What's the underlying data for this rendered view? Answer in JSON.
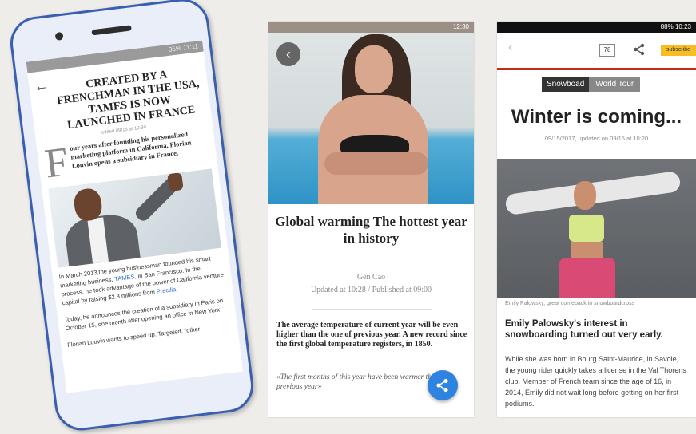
{
  "phone1": {
    "status_bar": "35% 11:11",
    "back_icon": "arrow-left-icon",
    "headline": "CREATED BY A FRENCHMAN IN THE USA, TAMES IS NOW LAUNCHED IN FRANCE",
    "edited": "edited 09/15 at 10:30",
    "dropcap": "F",
    "lede": "our years after founding his personalized marketing platform in California, Florian Louvin opens a subsidiary in France.",
    "para1_a": "In March 2013,the young businessman founded his smart marketing business, ",
    "para1_link": "TAMES",
    "para1_b": ", in San Francisco. In the process, he took advantage of the power of California venture capital by raising $2.8 millions from ",
    "para1_link2": "Precilia",
    "para1_c": ".",
    "para2": "Today, he announces the creation of a subsidiary in Paris on October 15, one month after opening an office in New York.",
    "para3": "Florian Louvin wants to speed up. Targeted, “other"
  },
  "phone2": {
    "status_bar": "12:30",
    "title": "Global warming The hottest year in history",
    "author": "Gen Cao",
    "updated": "Updated at 10:28 / Published at 09:00",
    "lead": "The average temperature of current year will be even higher than the one of previous year. A new record since the first global temperature registers, in 1850.",
    "quote": "«The first months of this year have been warmer than the previous year»",
    "share_icon": "share-icon"
  },
  "phone3": {
    "status_bar": "88% 10:23",
    "comment_count": "78",
    "subscribe": "subscribe",
    "tag1": "Snowboad",
    "tag2": "World Tour",
    "headline": "Winter is coming...",
    "date": "09/15/2017, updated on 09/15 at 10:20",
    "caption": "Emily Palowsky, great comeback in snowboardcross",
    "subhead": "Emily Palowsky's interest in snowboarding turned out very early.",
    "body": "While she was born in Bourg Saint-Maurice, in Savoie, the young rider quickly takes a license in the Val Thorens club. Member of French team since the age of 16, in 2014, Emily did not wait long before getting on her first podiums."
  }
}
